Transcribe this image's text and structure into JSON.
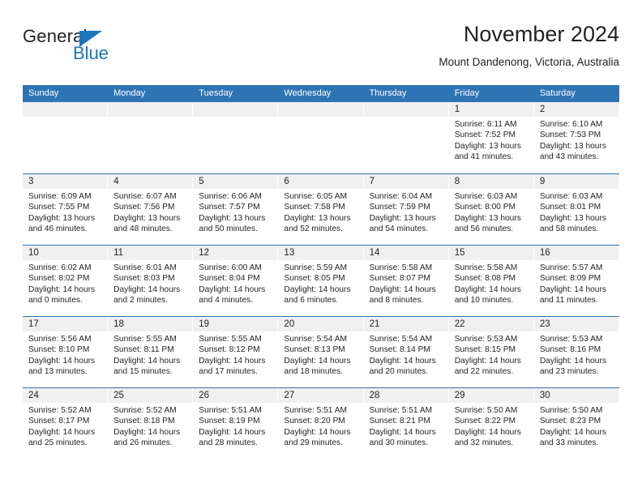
{
  "brand": {
    "name_part1": "General",
    "name_part2": "Blue",
    "triangle_color": "#1b76bc",
    "logo_icon": "triangle-icon"
  },
  "header": {
    "title": "November 2024",
    "location": "Mount Dandenong, Victoria, Australia"
  },
  "theme": {
    "header_blue": "#2e74b5",
    "daynum_band": "#f0f0f0",
    "text": "#231f20"
  },
  "calendar": {
    "weekday_headers": [
      "Sunday",
      "Monday",
      "Tuesday",
      "Wednesday",
      "Thursday",
      "Friday",
      "Saturday"
    ],
    "labels": {
      "sunrise": "Sunrise:",
      "sunset": "Sunset:",
      "daylight": "Daylight:"
    },
    "weeks": [
      [
        {
          "day": "",
          "empty": true
        },
        {
          "day": "",
          "empty": true
        },
        {
          "day": "",
          "empty": true
        },
        {
          "day": "",
          "empty": true
        },
        {
          "day": "",
          "empty": true
        },
        {
          "day": "1",
          "sunrise": "Sunrise: 6:11 AM",
          "sunset": "Sunset: 7:52 PM",
          "daylight_line1": "Daylight: 13 hours",
          "daylight_line2": "and 41 minutes."
        },
        {
          "day": "2",
          "sunrise": "Sunrise: 6:10 AM",
          "sunset": "Sunset: 7:53 PM",
          "daylight_line1": "Daylight: 13 hours",
          "daylight_line2": "and 43 minutes."
        }
      ],
      [
        {
          "day": "3",
          "sunrise": "Sunrise: 6:09 AM",
          "sunset": "Sunset: 7:55 PM",
          "daylight_line1": "Daylight: 13 hours",
          "daylight_line2": "and 46 minutes."
        },
        {
          "day": "4",
          "sunrise": "Sunrise: 6:07 AM",
          "sunset": "Sunset: 7:56 PM",
          "daylight_line1": "Daylight: 13 hours",
          "daylight_line2": "and 48 minutes."
        },
        {
          "day": "5",
          "sunrise": "Sunrise: 6:06 AM",
          "sunset": "Sunset: 7:57 PM",
          "daylight_line1": "Daylight: 13 hours",
          "daylight_line2": "and 50 minutes."
        },
        {
          "day": "6",
          "sunrise": "Sunrise: 6:05 AM",
          "sunset": "Sunset: 7:58 PM",
          "daylight_line1": "Daylight: 13 hours",
          "daylight_line2": "and 52 minutes."
        },
        {
          "day": "7",
          "sunrise": "Sunrise: 6:04 AM",
          "sunset": "Sunset: 7:59 PM",
          "daylight_line1": "Daylight: 13 hours",
          "daylight_line2": "and 54 minutes."
        },
        {
          "day": "8",
          "sunrise": "Sunrise: 6:03 AM",
          "sunset": "Sunset: 8:00 PM",
          "daylight_line1": "Daylight: 13 hours",
          "daylight_line2": "and 56 minutes."
        },
        {
          "day": "9",
          "sunrise": "Sunrise: 6:03 AM",
          "sunset": "Sunset: 8:01 PM",
          "daylight_line1": "Daylight: 13 hours",
          "daylight_line2": "and 58 minutes."
        }
      ],
      [
        {
          "day": "10",
          "sunrise": "Sunrise: 6:02 AM",
          "sunset": "Sunset: 8:02 PM",
          "daylight_line1": "Daylight: 14 hours",
          "daylight_line2": "and 0 minutes."
        },
        {
          "day": "11",
          "sunrise": "Sunrise: 6:01 AM",
          "sunset": "Sunset: 8:03 PM",
          "daylight_line1": "Daylight: 14 hours",
          "daylight_line2": "and 2 minutes."
        },
        {
          "day": "12",
          "sunrise": "Sunrise: 6:00 AM",
          "sunset": "Sunset: 8:04 PM",
          "daylight_line1": "Daylight: 14 hours",
          "daylight_line2": "and 4 minutes."
        },
        {
          "day": "13",
          "sunrise": "Sunrise: 5:59 AM",
          "sunset": "Sunset: 8:05 PM",
          "daylight_line1": "Daylight: 14 hours",
          "daylight_line2": "and 6 minutes."
        },
        {
          "day": "14",
          "sunrise": "Sunrise: 5:58 AM",
          "sunset": "Sunset: 8:07 PM",
          "daylight_line1": "Daylight: 14 hours",
          "daylight_line2": "and 8 minutes."
        },
        {
          "day": "15",
          "sunrise": "Sunrise: 5:58 AM",
          "sunset": "Sunset: 8:08 PM",
          "daylight_line1": "Daylight: 14 hours",
          "daylight_line2": "and 10 minutes."
        },
        {
          "day": "16",
          "sunrise": "Sunrise: 5:57 AM",
          "sunset": "Sunset: 8:09 PM",
          "daylight_line1": "Daylight: 14 hours",
          "daylight_line2": "and 11 minutes."
        }
      ],
      [
        {
          "day": "17",
          "sunrise": "Sunrise: 5:56 AM",
          "sunset": "Sunset: 8:10 PM",
          "daylight_line1": "Daylight: 14 hours",
          "daylight_line2": "and 13 minutes."
        },
        {
          "day": "18",
          "sunrise": "Sunrise: 5:55 AM",
          "sunset": "Sunset: 8:11 PM",
          "daylight_line1": "Daylight: 14 hours",
          "daylight_line2": "and 15 minutes."
        },
        {
          "day": "19",
          "sunrise": "Sunrise: 5:55 AM",
          "sunset": "Sunset: 8:12 PM",
          "daylight_line1": "Daylight: 14 hours",
          "daylight_line2": "and 17 minutes."
        },
        {
          "day": "20",
          "sunrise": "Sunrise: 5:54 AM",
          "sunset": "Sunset: 8:13 PM",
          "daylight_line1": "Daylight: 14 hours",
          "daylight_line2": "and 18 minutes."
        },
        {
          "day": "21",
          "sunrise": "Sunrise: 5:54 AM",
          "sunset": "Sunset: 8:14 PM",
          "daylight_line1": "Daylight: 14 hours",
          "daylight_line2": "and 20 minutes."
        },
        {
          "day": "22",
          "sunrise": "Sunrise: 5:53 AM",
          "sunset": "Sunset: 8:15 PM",
          "daylight_line1": "Daylight: 14 hours",
          "daylight_line2": "and 22 minutes."
        },
        {
          "day": "23",
          "sunrise": "Sunrise: 5:53 AM",
          "sunset": "Sunset: 8:16 PM",
          "daylight_line1": "Daylight: 14 hours",
          "daylight_line2": "and 23 minutes."
        }
      ],
      [
        {
          "day": "24",
          "sunrise": "Sunrise: 5:52 AM",
          "sunset": "Sunset: 8:17 PM",
          "daylight_line1": "Daylight: 14 hours",
          "daylight_line2": "and 25 minutes."
        },
        {
          "day": "25",
          "sunrise": "Sunrise: 5:52 AM",
          "sunset": "Sunset: 8:18 PM",
          "daylight_line1": "Daylight: 14 hours",
          "daylight_line2": "and 26 minutes."
        },
        {
          "day": "26",
          "sunrise": "Sunrise: 5:51 AM",
          "sunset": "Sunset: 8:19 PM",
          "daylight_line1": "Daylight: 14 hours",
          "daylight_line2": "and 28 minutes."
        },
        {
          "day": "27",
          "sunrise": "Sunrise: 5:51 AM",
          "sunset": "Sunset: 8:20 PM",
          "daylight_line1": "Daylight: 14 hours",
          "daylight_line2": "and 29 minutes."
        },
        {
          "day": "28",
          "sunrise": "Sunrise: 5:51 AM",
          "sunset": "Sunset: 8:21 PM",
          "daylight_line1": "Daylight: 14 hours",
          "daylight_line2": "and 30 minutes."
        },
        {
          "day": "29",
          "sunrise": "Sunrise: 5:50 AM",
          "sunset": "Sunset: 8:22 PM",
          "daylight_line1": "Daylight: 14 hours",
          "daylight_line2": "and 32 minutes."
        },
        {
          "day": "30",
          "sunrise": "Sunrise: 5:50 AM",
          "sunset": "Sunset: 8:23 PM",
          "daylight_line1": "Daylight: 14 hours",
          "daylight_line2": "and 33 minutes."
        }
      ]
    ]
  }
}
